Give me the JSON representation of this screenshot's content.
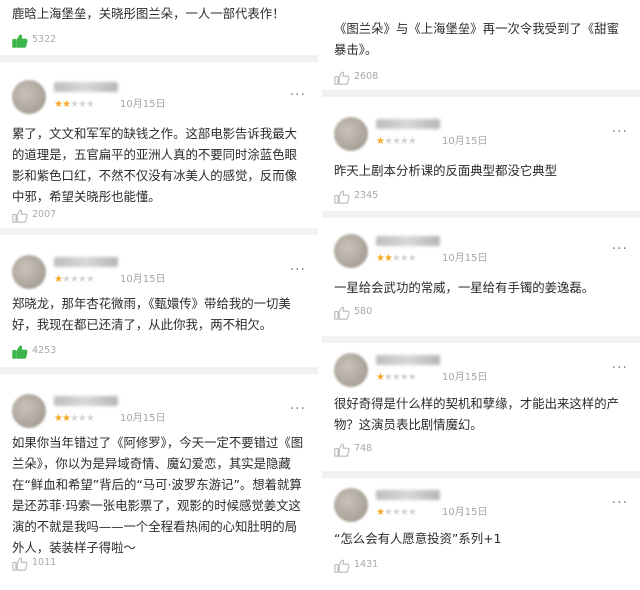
{
  "left_column": {
    "card0": {
      "text": "鹿晗上海堡垒，关晓彤图兰朵，一人一部代表作！",
      "likes": "5322",
      "liked": true
    },
    "card1": {
      "stars": 2,
      "date": "10月15日",
      "more": "···",
      "text": "累了，文文和军军的缺钱之作。这部电影告诉我最大的道理是，五官扁平的亚洲人真的不要同时涂蓝色眼影和紫色口红，不然不仅没有冰美人的感觉，反而像中邪，希望关晓彤也能懂。",
      "likes": "2007",
      "liked": false
    },
    "card2": {
      "stars": 1,
      "date": "10月15日",
      "more": "···",
      "text": "郑晓龙，那年杏花微雨，《甄嬛传》带给我的一切美好，我现在都已还清了，从此你我，两不相欠。",
      "likes": "4253",
      "liked": true
    },
    "card3": {
      "stars": 2,
      "date": "10月15日",
      "more": "···",
      "text": "如果你当年错过了《阿修罗》，今天一定不要错过《图兰朵》，你以为是异域奇情、魔幻爱恋，其实是隐藏在“鲜血和希望”背后的“马可·波罗东游记”。想着就算是还苏菲·玛索一张电影票了，观影的时候感觉姜文这演的不就是我吗——一个全程看热闹的心知肚明的局外人，装装样子得啦～",
      "likes": "1011",
      "liked": false
    }
  },
  "right_column": {
    "card0": {
      "text": "《图兰朵》与《上海堡垒》再一次令我受到了《甜蜜暴击》。",
      "likes": "2608",
      "liked": false
    },
    "card1": {
      "stars": 1,
      "date": "10月15日",
      "more": "···",
      "text": "昨天上剧本分析课的反面典型都没它典型",
      "likes": "2345",
      "liked": false
    },
    "card2": {
      "stars": 2,
      "date": "10月15日",
      "more": "···",
      "text": "一星给会武功的常威，一星给有手镯的姜逸磊。",
      "likes": "580",
      "liked": false
    },
    "card3": {
      "stars": 1,
      "date": "10月15日",
      "more": "···",
      "text": "很好奇得是什么样的契机和孽缘，才能出来这样的产物？这演员表比剧情魔幻。",
      "likes": "748",
      "liked": false
    },
    "card4": {
      "stars": 1,
      "date": "10月15日",
      "more": "···",
      "text": "“怎么会有人愿意投资”系列+1",
      "likes": "1431",
      "liked": false
    }
  },
  "colors": {
    "star": "#f5a623",
    "liked": "#3cb64a",
    "unliked": "#b8b8b8",
    "divider": "#f2f2f2"
  },
  "icons": {
    "like": "thumbs-up-icon",
    "more": "more-dots-icon"
  }
}
